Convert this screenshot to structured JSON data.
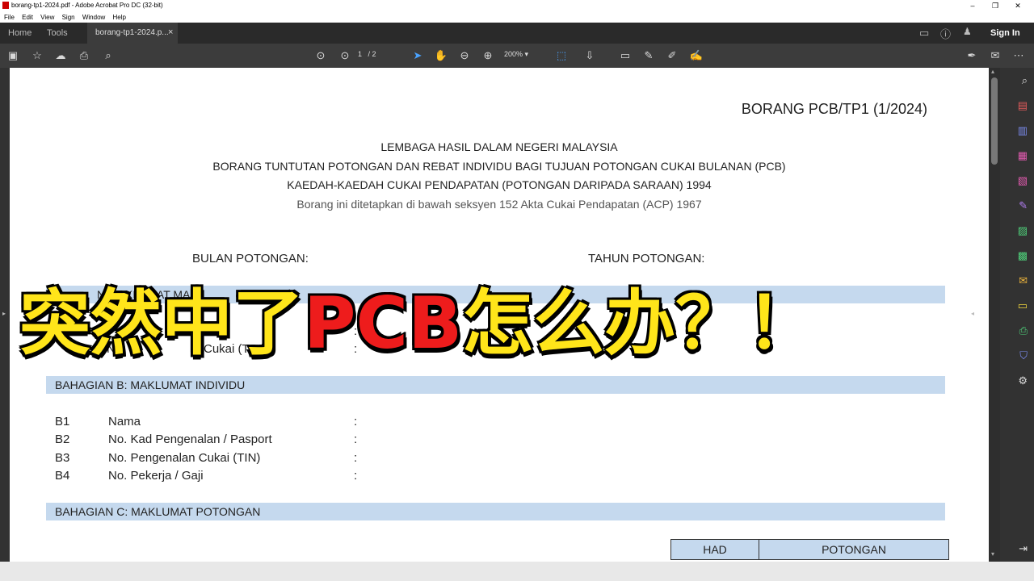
{
  "window": {
    "title": "borang-tp1-2024.pdf - Adobe Acrobat Pro DC (32-bit)",
    "controls": [
      "–",
      "❐",
      "✕"
    ]
  },
  "menu": [
    "File",
    "Edit",
    "View",
    "Sign",
    "Window",
    "Help"
  ],
  "tabs": {
    "home": "Home",
    "tools": "Tools",
    "doc": "borang-tp1-2024.p...",
    "close": "×"
  },
  "toolbar": {
    "page_current": "1",
    "page_total": "/ 2",
    "zoom": "200%",
    "sign_in": "Sign In"
  },
  "document": {
    "form_code": "BORANG PCB/TP1 (1/2024)",
    "heading_lines": [
      "LEMBAGA HASIL DALAM NEGERI MALAYSIA",
      "BORANG TUNTUTAN POTONGAN DAN REBAT INDIVIDU BAGI TUJUAN POTONGAN CUKAI BULANAN (PCB)",
      "KAEDAH-KAEDAH CUKAI PENDAPATAN (POTONGAN DARIPADA SARAAN) 1994"
    ],
    "subtitle": "Borang ini ditetapkan di bawah seksyen 152 Akta Cukai Pendapatan (ACP) 1967",
    "bulan_label": "BULAN POTONGAN:",
    "tahun_label": "TAHUN POTONGAN:",
    "section_a_partial": "N MAKLUMAT MAJ",
    "section_a_row_partial": "No",
    "section_a_row_tail": "Cukai (TIN)",
    "section_b_title": "BAHAGIAN B: MAKLUMAT INDIVIDU",
    "section_b_rows": [
      {
        "code": "B1",
        "label": "Nama",
        "colon": ":"
      },
      {
        "code": "B2",
        "label": "No. Kad Pengenalan / Pasport",
        "colon": ":"
      },
      {
        "code": "B3",
        "label": "No. Pengenalan Cukai (TIN)",
        "colon": ":"
      },
      {
        "code": "B4",
        "label": "No. Pekerja / Gaji",
        "colon": ":"
      }
    ],
    "section_c_title": "BAHAGIAN C: MAKLUMAT POTONGAN",
    "table_headers": [
      "HAD",
      "POTONGAN"
    ]
  },
  "overlay": {
    "yellow_part1": "突然中了",
    "red_part": "PCB",
    "yellow_part2": "怎么办？！"
  },
  "colors": {
    "section_bar": "#c5d9ee",
    "overlay_yellow": "#ffe51a",
    "overlay_red": "#ee1c1c"
  }
}
